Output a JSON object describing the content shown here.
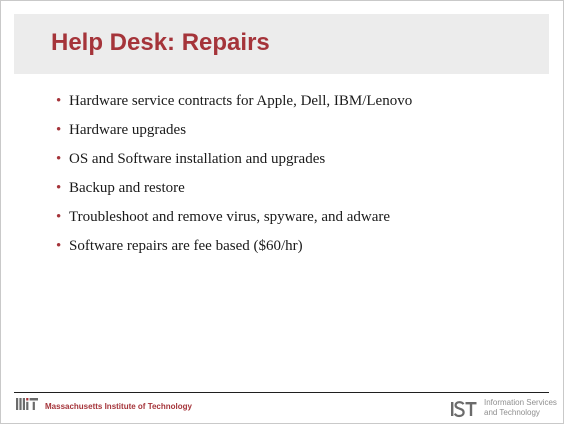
{
  "slide": {
    "title": "Help Desk: Repairs",
    "bullet_marker": "•",
    "bullets": [
      "Hardware service contracts for Apple, Dell, IBM/Lenovo",
      "Hardware upgrades",
      "OS and Software installation and upgrades",
      "Backup and restore",
      "Troubleshoot and remove virus, spyware, and adware",
      "Software repairs are fee based ($60/hr)"
    ]
  },
  "footer": {
    "mit_logo_text": "MIT",
    "institution": "Massachusetts Institute of Technology",
    "ist_logo_text": "IST",
    "ist_line1": "Information Services",
    "ist_line2": "and Technology"
  },
  "colors": {
    "accent": "#a5343a",
    "title_band": "#ececec",
    "body_text": "#1a1a1a",
    "footer_gray": "#8f8f8f",
    "mit_logo": "#6b6b6b"
  },
  "icons": {
    "mit": "mit-logo-icon",
    "ist": "ist-logo-icon"
  }
}
